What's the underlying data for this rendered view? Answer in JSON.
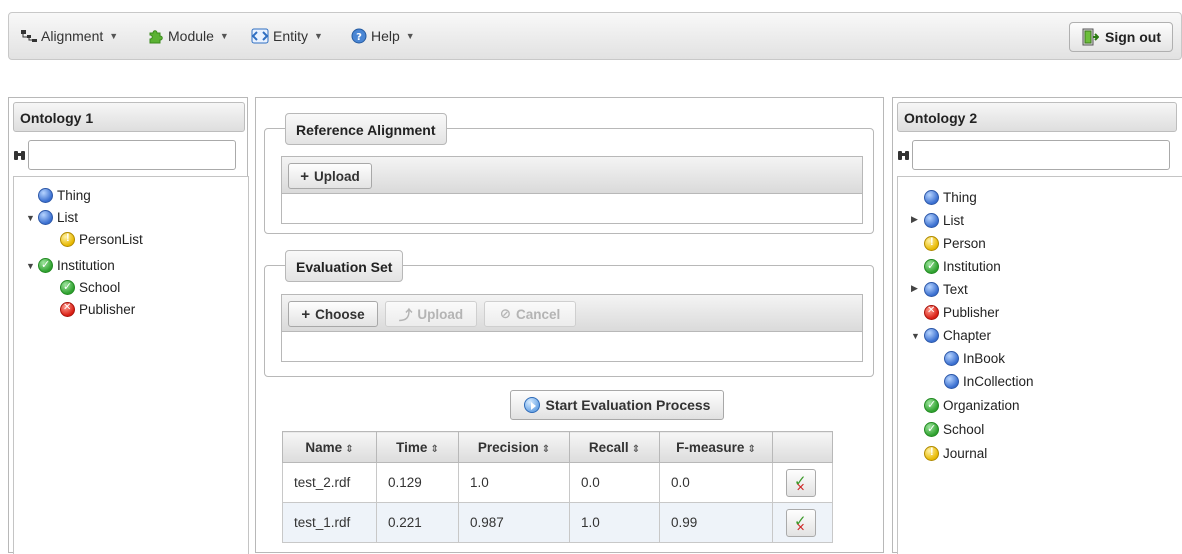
{
  "menubar": {
    "items": [
      {
        "label": "Alignment",
        "icon": "alignment-tree-icon"
      },
      {
        "label": "Module",
        "icon": "puzzle-icon"
      },
      {
        "label": "Entity",
        "icon": "entity-icon"
      },
      {
        "label": "Help",
        "icon": "help-icon"
      }
    ],
    "signout_label": "Sign out"
  },
  "ontology1": {
    "title": "Ontology 1",
    "search_value": "",
    "tree": [
      {
        "label": "Thing",
        "icon": "class"
      },
      {
        "label": "List",
        "icon": "class"
      },
      {
        "label": "PersonList",
        "icon": "warning"
      },
      {
        "label": "Institution",
        "icon": "ok"
      },
      {
        "label": "School",
        "icon": "ok"
      },
      {
        "label": "Publisher",
        "icon": "error"
      }
    ]
  },
  "center": {
    "reference": {
      "legend": "Reference Alignment",
      "upload_label": "Upload"
    },
    "evaluation": {
      "legend": "Evaluation Set",
      "choose_label": "Choose",
      "upload_label": "Upload",
      "cancel_label": "Cancel"
    },
    "start_label": "Start Evaluation Process",
    "table": {
      "columns": [
        "Name",
        "Time",
        "Precision",
        "Recall",
        "F-measure"
      ],
      "rows": [
        [
          "test_2.rdf",
          "0.129",
          "1.0",
          "0.0",
          "0.0"
        ],
        [
          "test_1.rdf",
          "0.221",
          "0.987",
          "1.0",
          "0.99"
        ]
      ]
    }
  },
  "ontology2": {
    "title": "Ontology 2",
    "search_value": "",
    "tree": [
      {
        "label": "Thing",
        "icon": "class"
      },
      {
        "label": "List",
        "icon": "class"
      },
      {
        "label": "Person",
        "icon": "warning"
      },
      {
        "label": "Institution",
        "icon": "ok"
      },
      {
        "label": "Text",
        "icon": "class"
      },
      {
        "label": "Publisher",
        "icon": "error"
      },
      {
        "label": "Chapter",
        "icon": "class"
      },
      {
        "label": "InBook",
        "icon": "class"
      },
      {
        "label": "InCollection",
        "icon": "class"
      },
      {
        "label": "Organization",
        "icon": "ok"
      },
      {
        "label": "School",
        "icon": "ok"
      },
      {
        "label": "Journal",
        "icon": "warning"
      }
    ]
  }
}
